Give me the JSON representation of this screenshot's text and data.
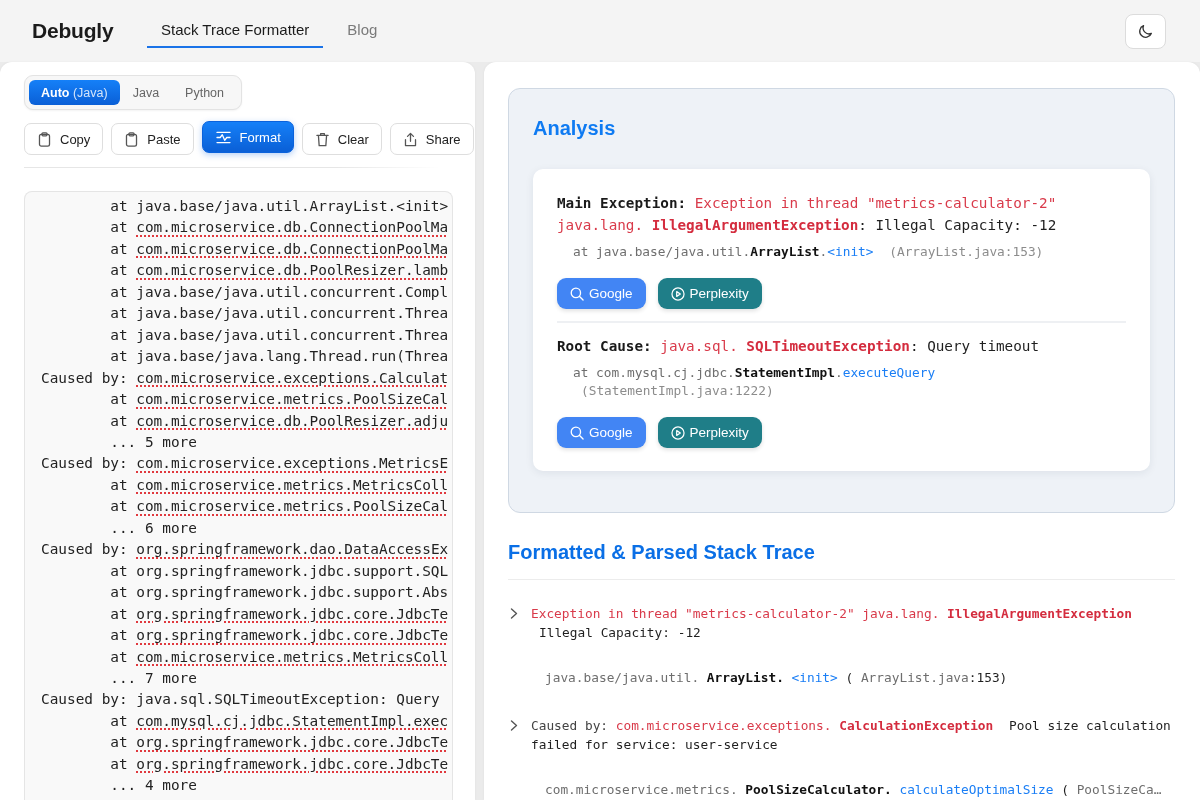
{
  "header": {
    "logo": "Debugly",
    "tabs": [
      {
        "label": "Stack Trace Formatter",
        "selected": true
      },
      {
        "label": "Blog",
        "selected": false
      }
    ]
  },
  "input": {
    "languages": [
      {
        "label": "Auto",
        "detail": "(Java)",
        "selected": true
      },
      {
        "label": "Java",
        "selected": false
      },
      {
        "label": "Python",
        "selected": false
      }
    ],
    "actions": [
      {
        "label": "Copy",
        "kind": "copy"
      },
      {
        "label": "Paste",
        "kind": "paste"
      },
      {
        "label": "Format",
        "kind": "format"
      },
      {
        "label": "Clear",
        "kind": "clear"
      },
      {
        "label": "Share",
        "kind": "share"
      }
    ],
    "lines": [
      {
        "kind": "frame",
        "lead": "at",
        "path": "java.base/java.util.ArrayList.<init>",
        "flagged": false
      },
      {
        "kind": "frame",
        "lead": "at",
        "path": "com.microservice.db.ConnectionPoolMa",
        "flagged": true
      },
      {
        "kind": "frame",
        "lead": "at",
        "path": "com.microservice.db.ConnectionPoolMa",
        "flagged": true
      },
      {
        "kind": "frame",
        "lead": "at",
        "path": "com.microservice.db.PoolResizer.lamb",
        "flagged": true
      },
      {
        "kind": "frame",
        "lead": "at",
        "path": "java.base/java.util.concurrent.Compl",
        "flagged": false
      },
      {
        "kind": "frame",
        "lead": "at",
        "path": "java.base/java.util.concurrent.Threa",
        "flagged": false
      },
      {
        "kind": "frame",
        "lead": "at",
        "path": "java.base/java.util.concurrent.Threa",
        "flagged": false
      },
      {
        "kind": "frame",
        "lead": "at",
        "path": "java.base/java.lang.Thread.run(Threa",
        "flagged": false
      },
      {
        "kind": "cause",
        "lead": "Caused by:",
        "path": "com.microservice.exceptions.Calculat",
        "flagged": true
      },
      {
        "kind": "frame",
        "lead": "at",
        "path": "com.microservice.metrics.PoolSizeCal",
        "flagged": true
      },
      {
        "kind": "frame",
        "lead": "at",
        "path": "com.microservice.db.PoolResizer.adju",
        "flagged": true
      },
      {
        "kind": "more",
        "text": "... 5 more",
        "flagged": false
      },
      {
        "kind": "cause",
        "lead": "Caused by:",
        "path": "com.microservice.exceptions.MetricsE",
        "flagged": true
      },
      {
        "kind": "frame",
        "lead": "at",
        "path": "com.microservice.metrics.MetricsColl",
        "flagged": true
      },
      {
        "kind": "frame",
        "lead": "at",
        "path": "com.microservice.metrics.PoolSizeCal",
        "flagged": true
      },
      {
        "kind": "more",
        "text": "... 6 more",
        "flagged": false
      },
      {
        "kind": "cause",
        "lead": "Caused by:",
        "path": "org.springframework.dao.DataAccessEx",
        "flagged": true
      },
      {
        "kind": "frame",
        "lead": "at",
        "path": "org.springframework.jdbc.support.SQL",
        "flagged": false
      },
      {
        "kind": "frame",
        "lead": "at",
        "path": "org.springframework.jdbc.support.Abs",
        "flagged": false
      },
      {
        "kind": "frame",
        "lead": "at",
        "path": "org.springframework.jdbc.core.JdbcTe",
        "flagged": true
      },
      {
        "kind": "frame",
        "lead": "at",
        "path": "org.springframework.jdbc.core.JdbcTe",
        "flagged": true
      },
      {
        "kind": "frame",
        "lead": "at",
        "path": "com.microservice.metrics.MetricsColl",
        "flagged": true
      },
      {
        "kind": "more",
        "text": "... 7 more",
        "flagged": false
      },
      {
        "kind": "cause",
        "lead": "Caused by:",
        "path": "java.sql.SQLTimeoutException: Query",
        "flagged": false
      },
      {
        "kind": "frame",
        "lead": "at",
        "path": "com.mysql.cj.jdbc.StatementImpl.exec",
        "flagged": true
      },
      {
        "kind": "frame",
        "lead": "at",
        "path": "org.springframework.jdbc.core.JdbcTe",
        "flagged": true
      },
      {
        "kind": "frame",
        "lead": "at",
        "path": "org.springframework.jdbc.core.JdbcTe",
        "flagged": true
      },
      {
        "kind": "more",
        "text": "... 4 more",
        "flagged": false
      }
    ]
  },
  "analysis": {
    "title": "Analysis",
    "entries": [
      {
        "summary": [
          {
            "text": "Main Exception:",
            "kind": "label"
          },
          {
            "text": " Exception in thread \"metrics-calculator-2\" java.lang.",
            "kind": "error"
          },
          {
            "text": " IllegalArgumentException",
            "kind": "exception"
          },
          {
            "text": ": Illegal Capacity: -12",
            "kind": "plain"
          }
        ],
        "frame": [
          {
            "text": "at java.base/java.util.",
            "kind": "muted"
          },
          {
            "text": "ArrayList",
            "kind": "type"
          },
          {
            "text": ".",
            "kind": "muted"
          },
          {
            "text": "<init>",
            "kind": "method"
          }
        ],
        "location": "(ArrayList.java:153)",
        "actions": [
          {
            "label": "Google",
            "kind": "google"
          },
          {
            "label": "Perplexity",
            "kind": "perplexity"
          }
        ]
      },
      {
        "summary": [
          {
            "text": "Root Cause:",
            "kind": "label"
          },
          {
            "text": " java.sql.",
            "kind": "error"
          },
          {
            "text": " SQLTimeoutException",
            "kind": "exception"
          },
          {
            "text": ": Query timeout",
            "kind": "plain"
          }
        ],
        "frame": [
          {
            "text": "at com.mysql.cj.jdbc.",
            "kind": "muted"
          },
          {
            "text": "StatementImpl",
            "kind": "type"
          },
          {
            "text": ".",
            "kind": "muted"
          },
          {
            "text": "executeQuery",
            "kind": "method"
          }
        ],
        "location": "(StatementImpl.java:1222)",
        "actions": [
          {
            "label": "Google",
            "kind": "google"
          },
          {
            "label": "Perplexity",
            "kind": "perplexity"
          }
        ]
      }
    ]
  },
  "parsed": {
    "title": "Formatted & Parsed Stack Trace",
    "items": [
      {
        "header": [
          {
            "text": "Exception in thread \"metrics-calculator-2\" java.lang.",
            "kind": "error"
          },
          {
            "text": " IllegalArgumentException",
            "kind": "exception"
          }
        ],
        "message": "Illegal Capacity: -12",
        "frames": [
          {
            "segments": [
              {
                "text": "java.base/java.util.",
                "kind": "muted"
              },
              {
                "text": " ArrayList.",
                "kind": "type"
              },
              {
                "text": " <init>",
                "kind": "method"
              },
              {
                "text": " (",
                "kind": "plain"
              },
              {
                "text": " ArrayList.java",
                "kind": "muted"
              },
              {
                "text": ":153)",
                "kind": "plain"
              }
            ]
          }
        ]
      },
      {
        "header": [
          {
            "text": "Caused by:",
            "kind": "prefix"
          },
          {
            "text": " com.microservice.exceptions.",
            "kind": "error"
          },
          {
            "text": " CalculationException",
            "kind": "exception"
          }
        ],
        "message": "Pool size calculation failed for service: user-service",
        "frames": [
          {
            "segments": [
              {
                "text": "com.microservice.metrics.",
                "kind": "muted"
              },
              {
                "text": " PoolSizeCalculator.",
                "kind": "type"
              },
              {
                "text": " calculateOptimalSize",
                "kind": "method"
              },
              {
                "text": " (",
                "kind": "plain"
              },
              {
                "text": " PoolSizeCa…",
                "kind": "muted"
              }
            ]
          }
        ]
      }
    ]
  }
}
